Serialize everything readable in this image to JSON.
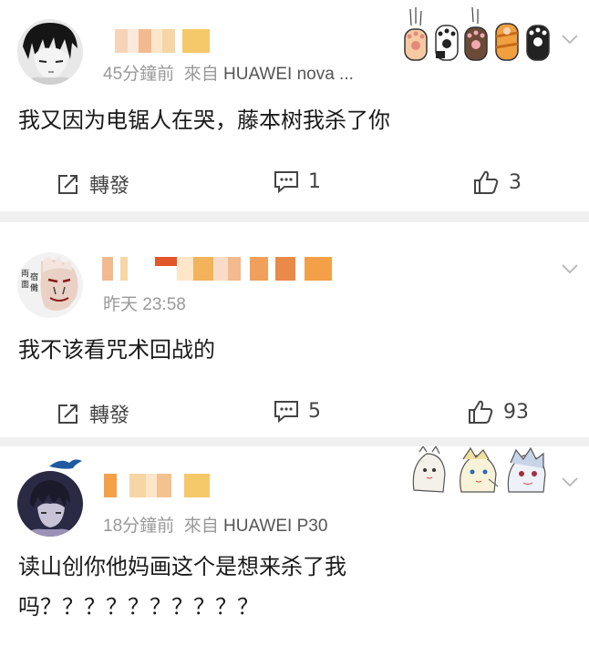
{
  "posts": [
    {
      "time": "45分鐘前",
      "source_prefix": "來自",
      "source": "HUAWEI nova ...",
      "text": "我又因为电锯人在哭，藤本树我杀了你",
      "repost_label": "轉發",
      "comment_count": "1",
      "like_count": "3"
    },
    {
      "time": "昨天 23:58",
      "text": "我不该看咒术回战的",
      "repost_label": "轉發",
      "comment_count": "5",
      "like_count": "93"
    },
    {
      "time": "18分鐘前",
      "source_prefix": "來自",
      "source": "HUAWEI P30",
      "text_line1": "读山创你他妈画这个是想来杀了我",
      "text_line2": "吗？？？？？？？？？？"
    }
  ],
  "colors": {
    "meta": "#999999",
    "text": "#1a1a1a",
    "separator": "#f0f0f0",
    "blur_orange": "#f3b35a",
    "blur_red": "#e3562a"
  },
  "icons": [
    "chevron-down-icon",
    "repost-icon",
    "comment-icon",
    "like-icon",
    "cat-paw-sticker",
    "anime-sticker"
  ]
}
